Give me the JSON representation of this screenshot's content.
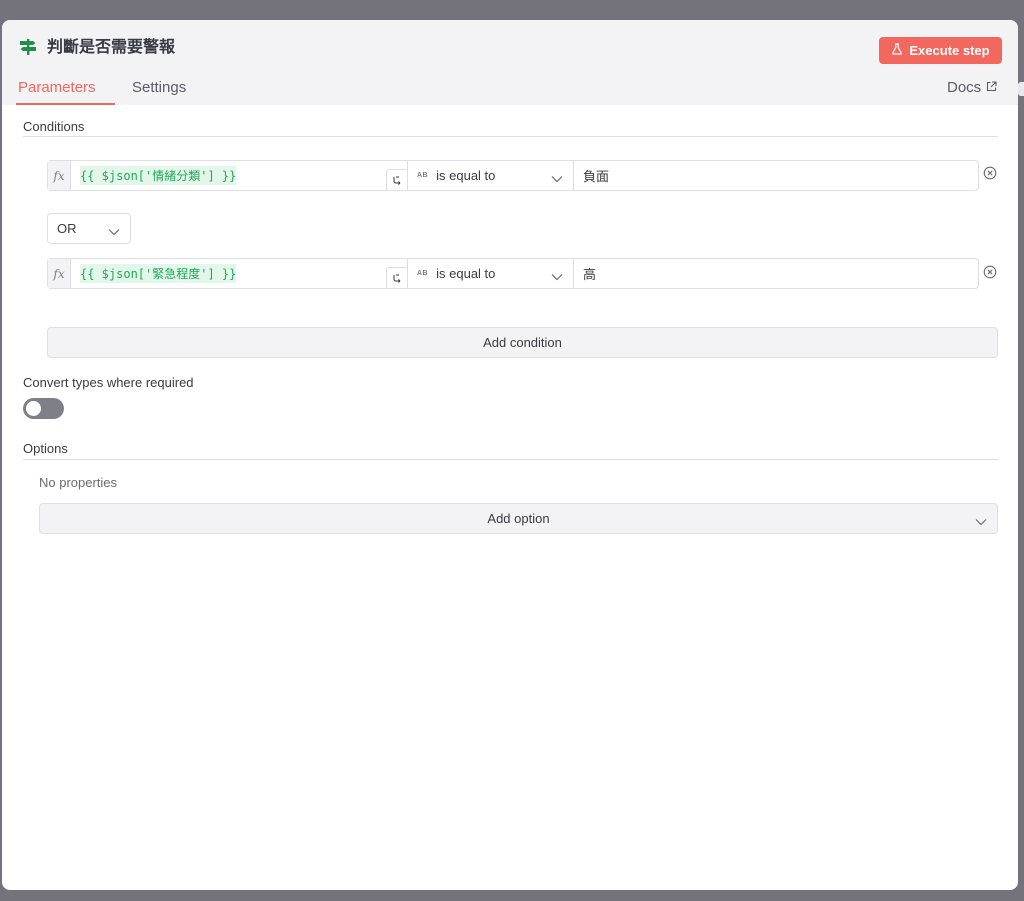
{
  "node": {
    "title": "判斷是否需要警報",
    "icon": "signpost-icon",
    "icon_color": "#1f8f4a"
  },
  "header": {
    "execute_label": "Execute step",
    "execute_icon": "flask-icon",
    "accent_color": "#f2685e",
    "docs_label": "Docs",
    "docs_icon": "external-link-icon"
  },
  "tabs": [
    {
      "label": "Parameters",
      "active": true
    },
    {
      "label": "Settings",
      "active": false
    }
  ],
  "conditions": {
    "label": "Conditions",
    "combinator": "OR",
    "rows": [
      {
        "fx": "fx",
        "expression": "{{ $json['情緒分類'] }}",
        "type_tag": "AB",
        "operator": "is equal to",
        "value": "負面"
      },
      {
        "fx": "fx",
        "expression": "{{ $json['緊急程度'] }}",
        "type_tag": "AB",
        "operator": "is equal to",
        "value": "高"
      }
    ],
    "add_label": "Add condition"
  },
  "convert_types": {
    "label": "Convert types where required",
    "enabled": false
  },
  "options": {
    "label": "Options",
    "empty_text": "No properties",
    "add_label": "Add option"
  }
}
